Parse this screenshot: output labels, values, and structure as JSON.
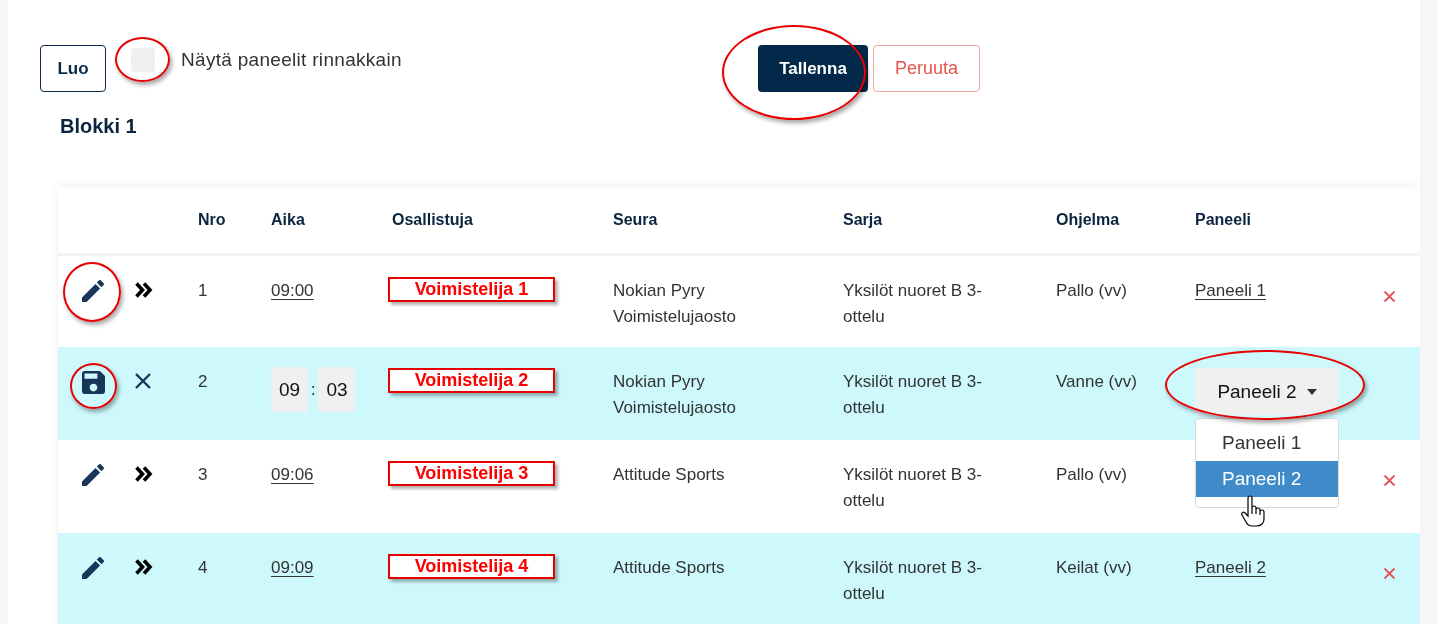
{
  "toolbar": {
    "create_button": "Luo",
    "side_by_side": {
      "label": "Näytä paneelit rinnakkain",
      "checked": false,
      "circled": true
    },
    "save_button": {
      "label": "Tallenna",
      "circled": true
    },
    "cancel_button": "Peruuta"
  },
  "block_title": "Blokki 1",
  "table": {
    "columns": [
      "Nro",
      "Aika",
      "Osallistuja",
      "Seura",
      "Sarja",
      "Ohjelma",
      "Paneeli"
    ],
    "rows": [
      {
        "editing": false,
        "action_circled": true,
        "nro": "1",
        "time": "09:00",
        "participant": "Voimistelija 1",
        "club": "Nokian Pyry Voimistelujaosto",
        "series": "Yksilöt nuoret B 3-ottelu",
        "program": "Pallo (vv)",
        "panel": "Paneeli 1"
      },
      {
        "editing": true,
        "action_circled": true,
        "nro": "2",
        "time_edit": {
          "hours": "09",
          "separator": ":",
          "minutes": "03"
        },
        "participant": "Voimistelija 2",
        "club": "Nokian Pyry Voimistelujaosto",
        "series": "Yksilöt nuoret B 3-ottelu",
        "program": "Vanne (vv)",
        "panel_select": {
          "value": "Paneeli 2",
          "expanded": true,
          "circled": true,
          "options": [
            {
              "label": "Paneeli 1",
              "selected": false
            },
            {
              "label": "Paneeli 2",
              "selected": true
            }
          ]
        }
      },
      {
        "editing": false,
        "action_circled": false,
        "nro": "3",
        "time": "09:06",
        "participant": "Voimistelija 3",
        "club": "Attitude Sports",
        "series": "Yksilöt nuoret B 3-ottelu",
        "program": "Pallo (vv)"
      },
      {
        "editing": false,
        "action_circled": false,
        "nro": "4",
        "time": "09:09",
        "participant": "Voimistelija 4",
        "club": "Attitude Sports",
        "series": "Yksilöt nuoret B 3-ottelu",
        "program": "Keilat (vv)",
        "panel": "Paneeli 2"
      }
    ]
  }
}
